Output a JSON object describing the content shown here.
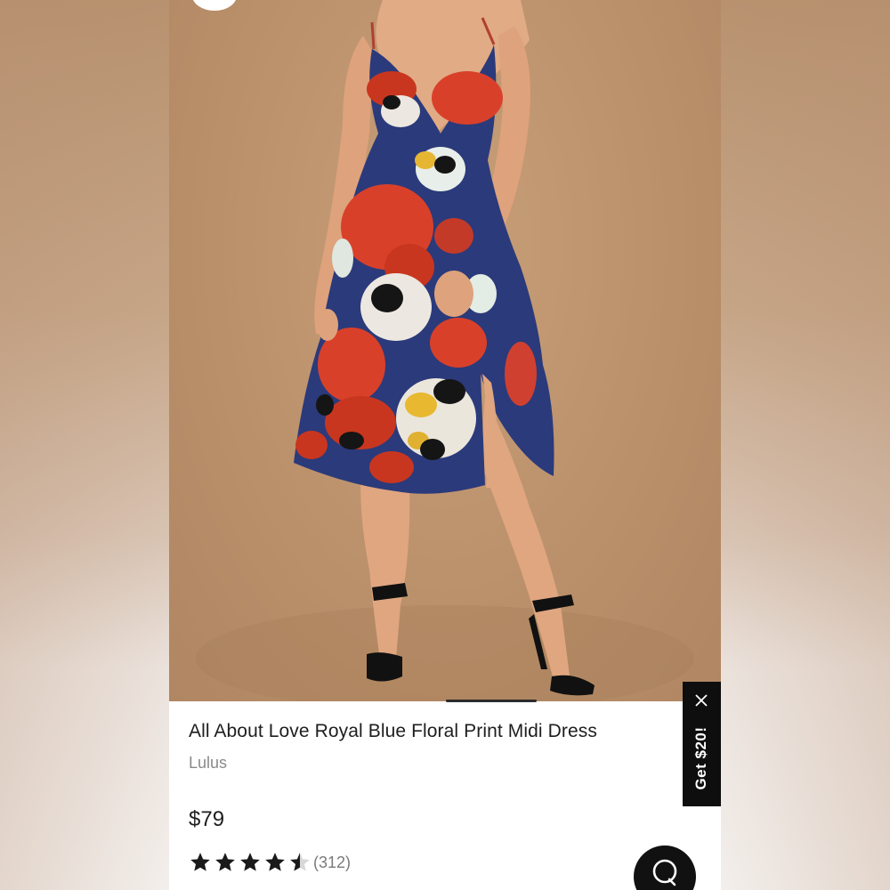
{
  "product": {
    "title": "All About Love Royal Blue Floral Print Midi Dress",
    "brand": "Lulus",
    "price": "$79",
    "rating": 4.5,
    "rating_max": 5,
    "review_count": "(312)"
  },
  "promo": {
    "label": "Get $20!"
  },
  "colors": {
    "accent": "#111111",
    "photo_background": "#bb916b",
    "dress_navy": "#2b3a7a",
    "flower_red": "#d9402a"
  },
  "icons": {
    "promo_close": "close-icon",
    "chat": "chat-bubble-icon",
    "star": "star-icon"
  },
  "carousel": {
    "indicator": true
  }
}
